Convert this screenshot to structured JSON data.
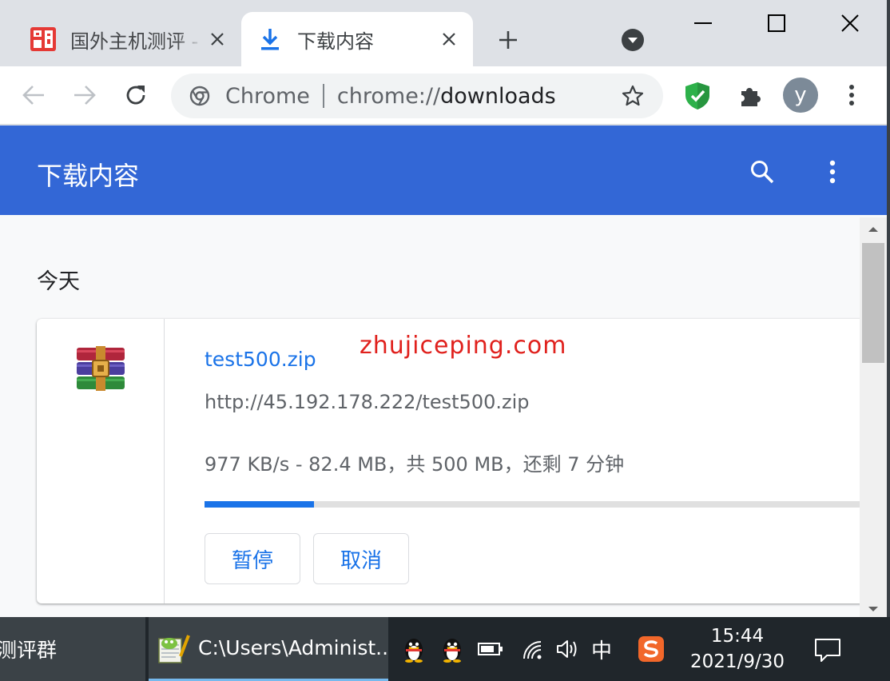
{
  "tabs": [
    {
      "title": "国外主机测评 - ",
      "favicon": "zhujiceping-favicon"
    },
    {
      "title": "下载内容",
      "favicon": "download-icon",
      "active": true
    }
  ],
  "toolbar": {
    "chip": "Chrome",
    "url_prefix": "chrome://",
    "url_path": "downloads",
    "avatar": "y"
  },
  "downloads": {
    "title": "下载内容",
    "date_heading": "今天",
    "watermark": "zhujiceping.com",
    "items": [
      {
        "file_name": "test500.zip",
        "url": "http://45.192.178.222/test500.zip",
        "status": "977 KB/s - 82.4 MB，共 500 MB，还剩 7 分钟",
        "progress": 0.165,
        "pause_label": "暂停",
        "cancel_label": "取消",
        "icon": "winrar-archive-icon"
      }
    ]
  },
  "taskbar": {
    "item1": "测评群",
    "item2": "C:\\Users\\Administ...",
    "ime": "中",
    "time": "15:44",
    "date": "2021/9/30"
  },
  "colors": {
    "header": "#3367d6",
    "accent": "#1a73e8",
    "watermark": "#e0211d",
    "taskbar": "#20262b"
  }
}
